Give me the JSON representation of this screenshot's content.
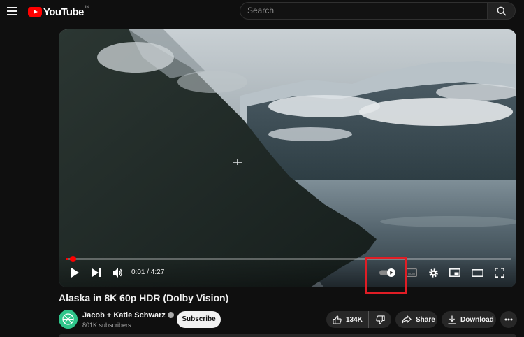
{
  "header": {
    "logo_text": "YouTube",
    "logo_country": "IN",
    "search_placeholder": "Search"
  },
  "player": {
    "current_time": "0:01",
    "duration": "4:27",
    "time_display": "0:01 / 4:27",
    "progress_fraction": 0.004,
    "autoplay_state": "on"
  },
  "video": {
    "title": "Alaska in 8K 60p HDR (Dolby Vision)"
  },
  "channel": {
    "name": "Jacob + Katie Schwarz",
    "subscribers": "801K subscribers",
    "subscribe_label": "Subscribe"
  },
  "actions": {
    "likes": "134K",
    "share_label": "Share",
    "download_label": "Download"
  },
  "icons": [
    "menu-icon",
    "youtube-logo",
    "search-icon",
    "play-icon",
    "next-icon",
    "volume-icon",
    "autoplay-toggle-icon",
    "captions-icon",
    "settings-icon",
    "miniplayer-icon",
    "theater-icon",
    "fullscreen-icon",
    "like-icon",
    "dislike-icon",
    "share-icon",
    "download-icon",
    "more-icon",
    "verified-icon"
  ],
  "colors": {
    "background": "#0f0f0f",
    "accent_red": "#ff0000",
    "highlight_box": "#e01d25",
    "pill_bg": "#272727"
  }
}
